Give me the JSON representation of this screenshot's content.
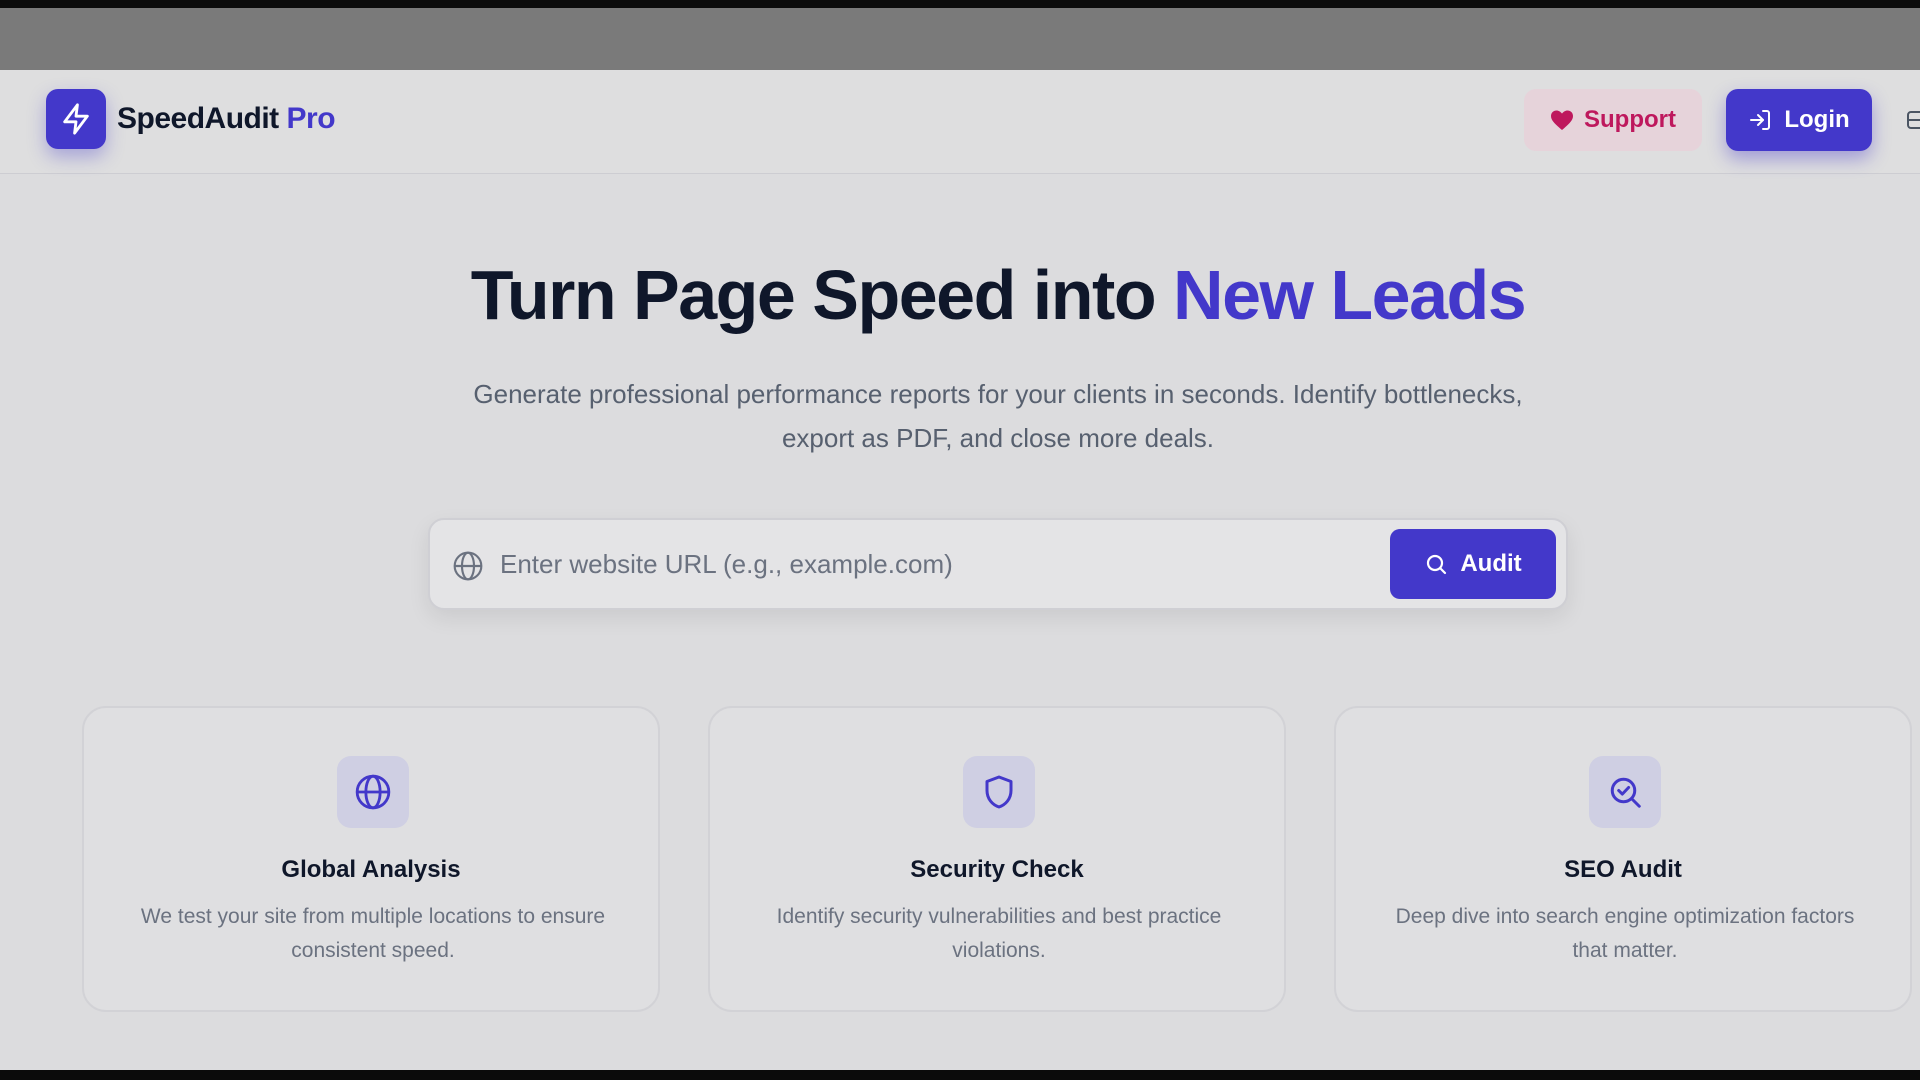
{
  "brand": {
    "name": "SpeedAudit",
    "suffix": "Pro",
    "logo_icon": "lightning-bolt-icon"
  },
  "header": {
    "support_label": "Support",
    "login_label": "Login"
  },
  "hero": {
    "title_main": "Turn Page Speed into ",
    "title_accent": "New Leads",
    "subtitle": "Generate professional performance reports for your clients in seconds. Identify bottlenecks, export as PDF, and close more deals."
  },
  "search": {
    "placeholder": "Enter website URL (e.g., example.com)",
    "value": "",
    "button_label": "Audit"
  },
  "features": [
    {
      "icon": "globe-icon",
      "title": "Global Analysis",
      "description": "We test your site from multiple locations to ensure consistent speed."
    },
    {
      "icon": "shield-icon",
      "title": "Security Check",
      "description": "Identify security vulnerabilities and best practice violations."
    },
    {
      "icon": "search-check-icon",
      "title": "SEO Audit",
      "description": "Deep dive into search engine optimization factors that matter."
    }
  ],
  "colors": {
    "accent": "#4338ca",
    "support": "#be185d",
    "heading": "#0f172a",
    "body_text": "#57606f"
  }
}
